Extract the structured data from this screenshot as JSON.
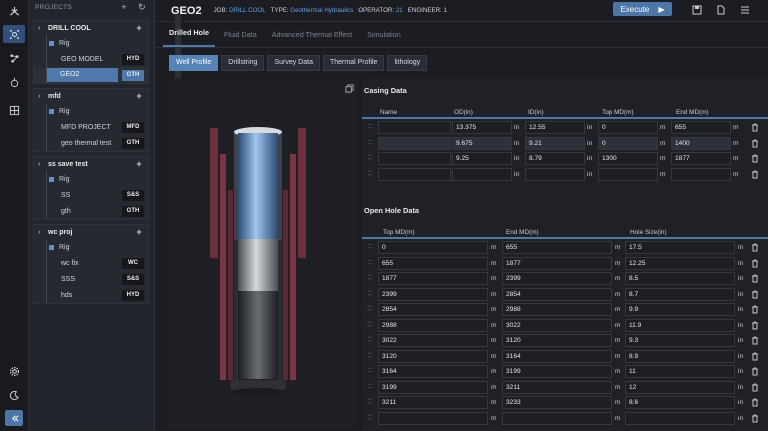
{
  "rail": {
    "icons": [
      "app-logo-icon",
      "network-icon",
      "connections-icon",
      "hand-icon",
      "table-icon",
      "settings-icon",
      "moon-icon",
      "collapse-icon"
    ]
  },
  "projects": {
    "header": "PROJECTS",
    "add_icon": "+",
    "refresh_icon": "↻",
    "items": [
      {
        "name": "DRILL COOL",
        "children": [
          {
            "label": "Rig",
            "tag": "",
            "kind": "rig"
          },
          {
            "label": "GEO MODEL",
            "tag": "HYD",
            "kind": "child"
          },
          {
            "label": "GEO2",
            "tag": "GTH",
            "kind": "child",
            "selected": true
          }
        ]
      },
      {
        "name": "mfd",
        "children": [
          {
            "label": "Rig",
            "tag": "",
            "kind": "rig"
          },
          {
            "label": "MFD PROJECT",
            "tag": "MFD",
            "kind": "child"
          },
          {
            "label": "geo thermal test",
            "tag": "GTH",
            "kind": "child"
          }
        ]
      },
      {
        "name": "ss save test",
        "children": [
          {
            "label": "Rig",
            "tag": "",
            "kind": "rig"
          },
          {
            "label": "SS",
            "tag": "S&S",
            "kind": "child"
          },
          {
            "label": "gth",
            "tag": "GTH",
            "kind": "child"
          }
        ]
      },
      {
        "name": "wc proj",
        "children": [
          {
            "label": "Rig",
            "tag": "",
            "kind": "rig"
          },
          {
            "label": "wc fix",
            "tag": "WC",
            "kind": "child"
          },
          {
            "label": "SSS",
            "tag": "S&S",
            "kind": "child"
          },
          {
            "label": "hds",
            "tag": "HYD",
            "kind": "child"
          }
        ]
      }
    ]
  },
  "header": {
    "title": "GEO2",
    "job_label": "JOB:",
    "job_value": "DRILL COOL",
    "type_label": "TYPE:",
    "type_value": "Geothermal Hydraulics",
    "operator_label": "OPERATOR:",
    "operator_value": "21",
    "engineer_label": "ENGINEER:",
    "engineer_value": "1",
    "execute_label": "Execute"
  },
  "tabs": [
    "Drilled Hole",
    "Fluid Data",
    "Advanced Thermal Effect",
    "Simulation"
  ],
  "active_tab": 0,
  "subtabs": [
    "Well Profile",
    "Drillstring",
    "Survey Data",
    "Thermal Profile",
    "lithology"
  ],
  "active_subtab": 0,
  "casing": {
    "title": "Casing Data",
    "columns": [
      "Name",
      "OD(in)",
      "ID(in)",
      "Top MD(m)",
      "End MD(m)"
    ],
    "rows": [
      {
        "name": "",
        "od": "13.375",
        "od_unit": "in",
        "id": "12.55",
        "id_unit": "in",
        "top": "0",
        "top_unit": "m",
        "end": "655",
        "end_unit": "m"
      },
      {
        "name": "",
        "od": "9.675",
        "od_unit": "in",
        "id": "9.21",
        "id_unit": "in",
        "top": "0",
        "top_unit": "m",
        "end": "1400",
        "end_unit": "m"
      },
      {
        "name": "",
        "od": "9.25",
        "od_unit": "in",
        "id": "8.79",
        "id_unit": "in",
        "top": "1300",
        "top_unit": "m",
        "end": "1877",
        "end_unit": "m"
      },
      {
        "name": "",
        "od": "",
        "od_unit": "in",
        "id": "",
        "id_unit": "in",
        "top": "",
        "top_unit": "m",
        "end": "",
        "end_unit": "m"
      }
    ]
  },
  "openhole": {
    "title": "Open Hole Data",
    "columns": [
      "Top MD(m)",
      "End MD(m)",
      "Hole Size(in)"
    ],
    "rows": [
      {
        "top": "0",
        "top_unit": "m",
        "end": "655",
        "end_unit": "m",
        "size": "17.5",
        "size_unit": "in"
      },
      {
        "top": "655",
        "top_unit": "m",
        "end": "1877",
        "end_unit": "m",
        "size": "12.25",
        "size_unit": "in"
      },
      {
        "top": "1877",
        "top_unit": "m",
        "end": "2399",
        "end_unit": "m",
        "size": "8.5",
        "size_unit": "in"
      },
      {
        "top": "2399",
        "top_unit": "m",
        "end": "2854",
        "end_unit": "m",
        "size": "8.7",
        "size_unit": "in"
      },
      {
        "top": "2854",
        "top_unit": "m",
        "end": "2988",
        "end_unit": "m",
        "size": "9.9",
        "size_unit": "in"
      },
      {
        "top": "2988",
        "top_unit": "m",
        "end": "3022",
        "end_unit": "m",
        "size": "11.9",
        "size_unit": "in"
      },
      {
        "top": "3022",
        "top_unit": "m",
        "end": "3120",
        "end_unit": "m",
        "size": "9.3",
        "size_unit": "in"
      },
      {
        "top": "3120",
        "top_unit": "m",
        "end": "3164",
        "end_unit": "m",
        "size": "8.9",
        "size_unit": "in"
      },
      {
        "top": "3164",
        "top_unit": "m",
        "end": "3199",
        "end_unit": "m",
        "size": "11",
        "size_unit": "in"
      },
      {
        "top": "3199",
        "top_unit": "m",
        "end": "3211",
        "end_unit": "m",
        "size": "12",
        "size_unit": "in"
      },
      {
        "top": "3211",
        "top_unit": "m",
        "end": "3233",
        "end_unit": "m",
        "size": "8.6",
        "size_unit": "in"
      },
      {
        "top": "",
        "top_unit": "m",
        "end": "",
        "end_unit": "m",
        "size": "",
        "size_unit": "in"
      }
    ]
  },
  "colors": {
    "accent": "#4f79ad",
    "link": "#5fa3e8",
    "casing": "#6e2f3d",
    "pipe": "#7fb0e0"
  }
}
